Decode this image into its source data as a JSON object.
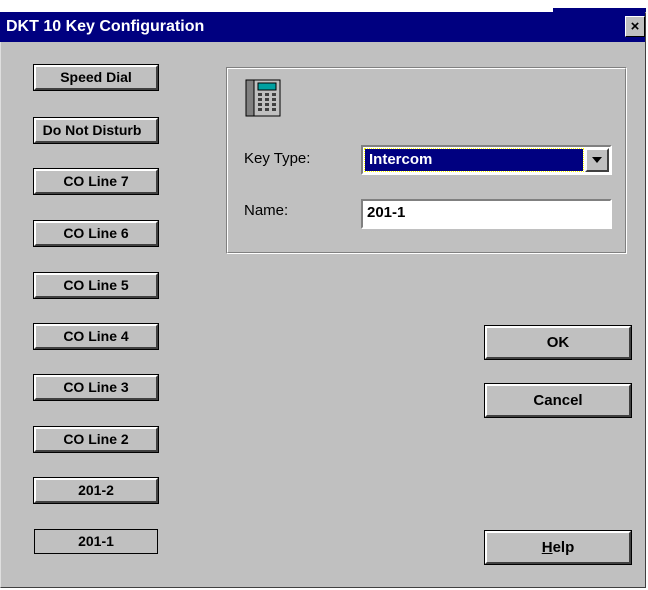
{
  "window": {
    "title": "DKT 10 Key Configuration",
    "close_symbol": "×"
  },
  "keys": [
    {
      "label": "Speed Dial"
    },
    {
      "label": "Do Not Disturb"
    },
    {
      "label": "CO Line 7"
    },
    {
      "label": "CO Line 6"
    },
    {
      "label": "CO Line 5"
    },
    {
      "label": "CO Line 4"
    },
    {
      "label": "CO Line 3"
    },
    {
      "label": "CO Line 2"
    },
    {
      "label": "201-2"
    },
    {
      "label": "201-1"
    }
  ],
  "form": {
    "icon": "telephone-icon",
    "key_type_label": "Key Type:",
    "key_type_value": "Intercom",
    "name_label": "Name:",
    "name_value": "201-1"
  },
  "buttons": {
    "ok": "OK",
    "cancel": "Cancel",
    "help_mnemonic": "H",
    "help_rest": "elp"
  },
  "colors": {
    "titlebar": "#000080",
    "face": "#c0c0c0",
    "selection": "#000080"
  }
}
